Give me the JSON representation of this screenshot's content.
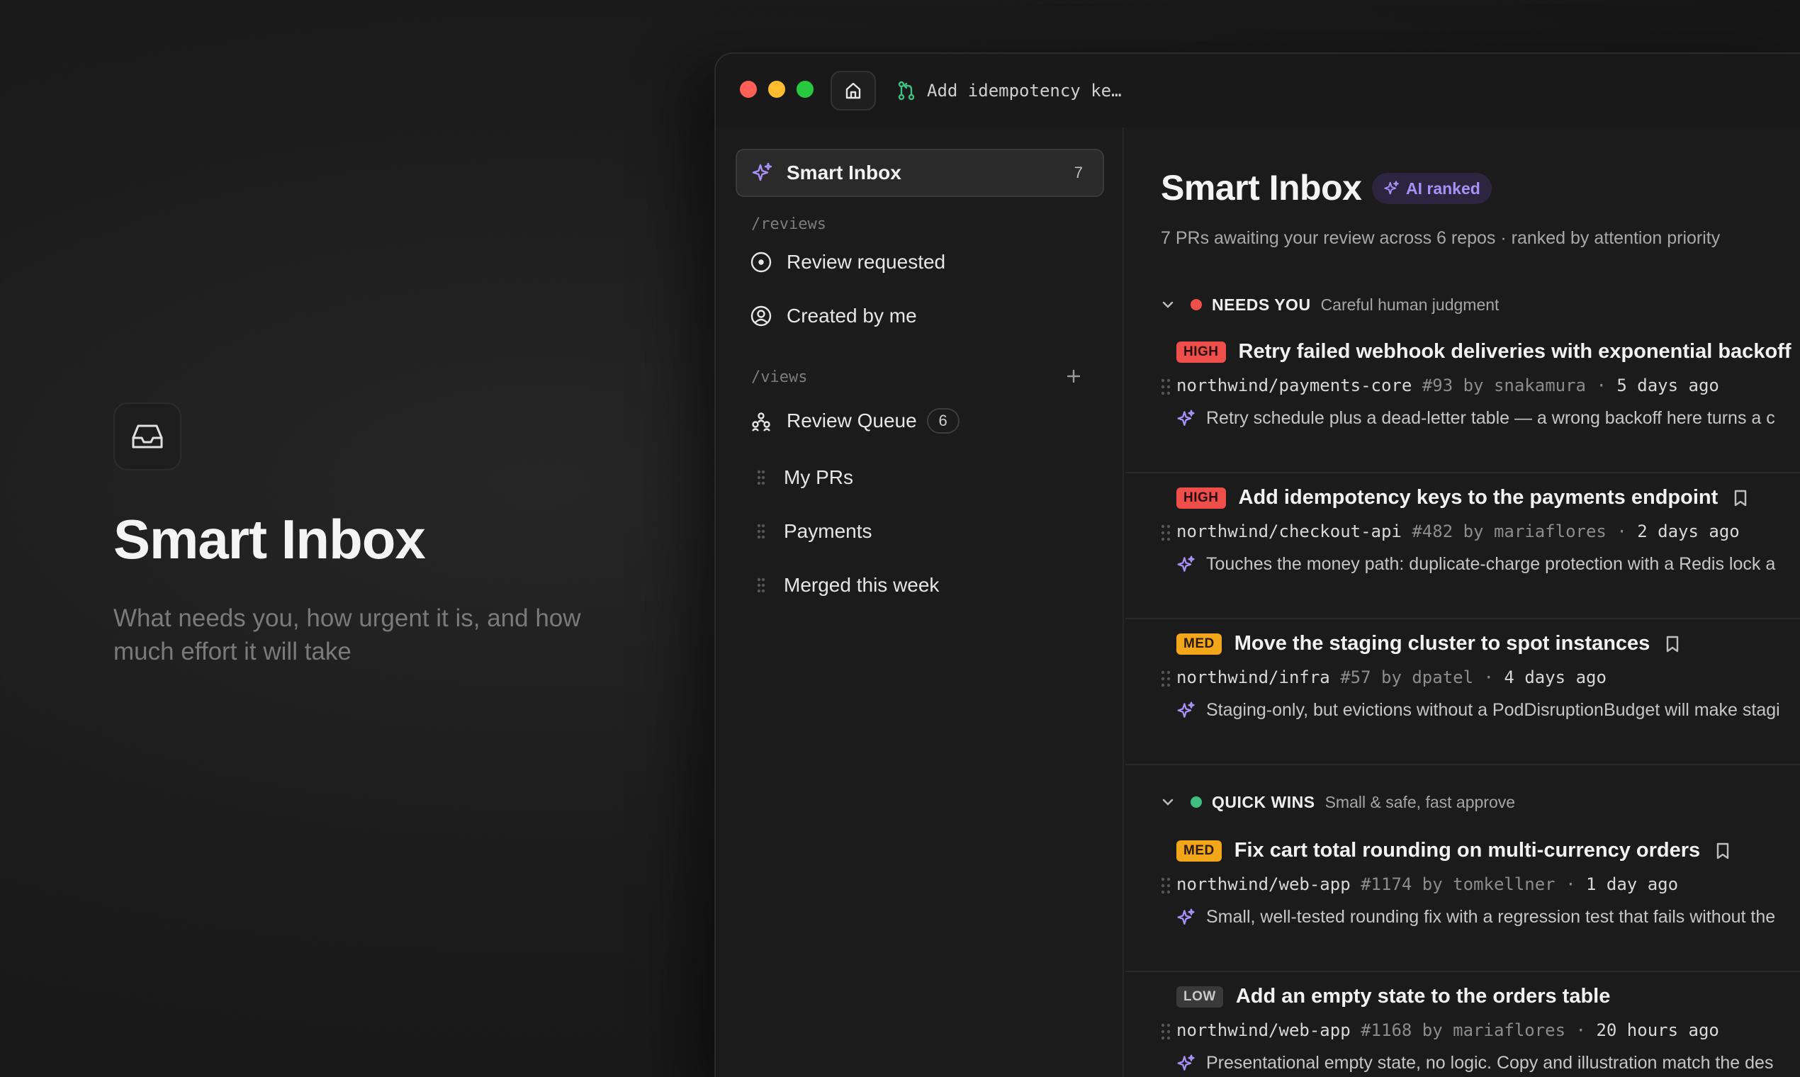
{
  "hero": {
    "title": "Smart Inbox",
    "subtitle": "What needs you, how urgent it is, and how much effort it will take",
    "icon": "inbox-icon"
  },
  "titlebar": {
    "tab_label": "Add idempotency ke…",
    "home_icon": "home-icon",
    "tab_icon": "git-pull-request-icon"
  },
  "sidebar": {
    "smart_inbox": {
      "label": "Smart Inbox",
      "count": "7"
    },
    "reviews_section": "/reviews",
    "reviews": [
      {
        "label": "Review requested",
        "icon": "circle-dot-icon"
      },
      {
        "label": "Created by me",
        "icon": "user-circle-icon"
      }
    ],
    "views_section": "/views",
    "views": [
      {
        "label": "Review Queue",
        "badge": "6",
        "icon": "group-icon"
      },
      {
        "label": "My PRs",
        "icon": "drag-handle-icon"
      },
      {
        "label": "Payments",
        "icon": "drag-handle-icon"
      },
      {
        "label": "Merged this week",
        "icon": "drag-handle-icon"
      }
    ]
  },
  "main": {
    "title": "Smart Inbox",
    "ai_badge": "AI ranked",
    "subtitle": "7 PRs awaiting your review across 6 repos · ranked by attention priority",
    "groups": [
      {
        "name": "NEEDS YOU",
        "description": "Careful human judgment",
        "color": "#ef4f4a",
        "items": [
          {
            "priority": "HIGH",
            "title": "Retry failed webhook deliveries with exponential backoff",
            "repo": "northwind/payments-core",
            "number": "#93",
            "author": "snakamura",
            "age": "5 days ago",
            "note": "Retry schedule plus a dead-letter table — a wrong backoff here turns a c",
            "bookmark": false
          },
          {
            "priority": "HIGH",
            "title": "Add idempotency keys to the payments endpoint",
            "repo": "northwind/checkout-api",
            "number": "#482",
            "author": "mariaflores",
            "age": "2 days ago",
            "note": "Touches the money path: duplicate-charge protection with a Redis lock a",
            "bookmark": true
          },
          {
            "priority": "MED",
            "title": "Move the staging cluster to spot instances",
            "repo": "northwind/infra",
            "number": "#57",
            "author": "dpatel",
            "age": "4 days ago",
            "note": "Staging-only, but evictions without a PodDisruptionBudget will make stagi",
            "bookmark": true
          }
        ]
      },
      {
        "name": "QUICK WINS",
        "description": "Small & safe, fast approve",
        "color": "#3fbf7f",
        "items": [
          {
            "priority": "MED",
            "title": "Fix cart total rounding on multi-currency orders",
            "repo": "northwind/web-app",
            "number": "#1174",
            "author": "tomkellner",
            "age": "1 day ago",
            "note": "Small, well-tested rounding fix with a regression test that fails without the",
            "bookmark": true
          },
          {
            "priority": "LOW",
            "title": "Add an empty state to the orders table",
            "repo": "northwind/web-app",
            "number": "#1168",
            "author": "mariaflores",
            "age": "20 hours ago",
            "note": "Presentational empty state, no logic. Copy and illustration match the des",
            "bookmark": false
          }
        ]
      }
    ]
  },
  "colors": {
    "accent_purple": "#a891f5",
    "high": "#ef4f4a",
    "med": "#f2a619",
    "quick_wins": "#3fbf7f"
  }
}
